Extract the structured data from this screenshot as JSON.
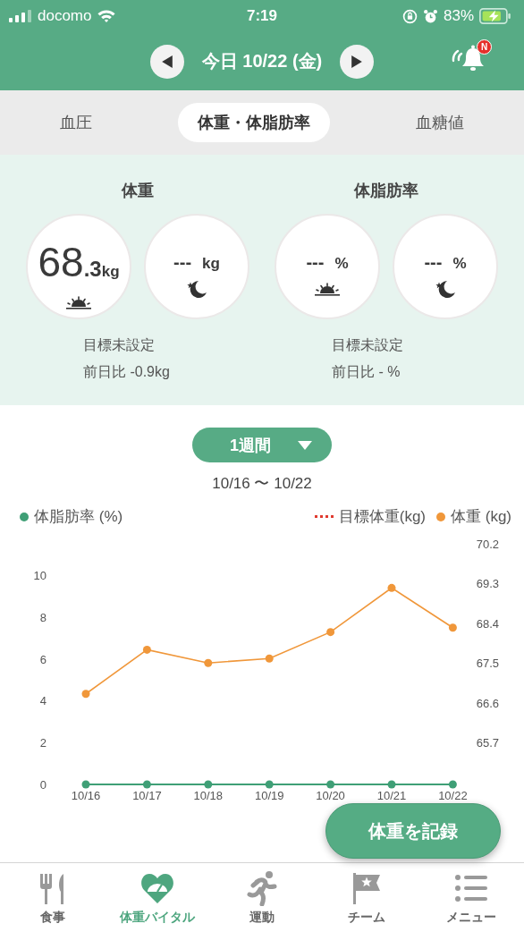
{
  "status_bar": {
    "carrier": "docomo",
    "time": "7:19",
    "battery": "83%"
  },
  "header": {
    "date": "今日 10/22 (金)",
    "badge": "N"
  },
  "tabs": [
    {
      "label": "血圧",
      "selected": false
    },
    {
      "label": "体重・体脂肪率",
      "selected": true
    },
    {
      "label": "血糖値",
      "selected": false
    }
  ],
  "metrics": [
    {
      "title": "体重",
      "readings": [
        {
          "value": "68",
          "fraction": ".3",
          "unit": "kg",
          "kind": "morning"
        },
        {
          "value": "---",
          "unit": "kg",
          "kind": "night"
        }
      ],
      "goal": "目標未設定",
      "diff": "前日比 -0.9kg"
    },
    {
      "title": "体脂肪率",
      "readings": [
        {
          "value": "---",
          "unit": "%",
          "kind": "morning"
        },
        {
          "value": "---",
          "unit": "%",
          "kind": "night"
        }
      ],
      "goal": "目標未設定",
      "diff": "前日比  - %"
    }
  ],
  "period": {
    "label": "1週間",
    "range": "10/16 〜 10/22"
  },
  "target_legend": {
    "label": "目標体重(kg)",
    "color": "#e03a2f"
  },
  "chart_data": {
    "type": "line",
    "categories": [
      "10/16",
      "10/17",
      "10/18",
      "10/19",
      "10/20",
      "10/21",
      "10/22"
    ],
    "series": [
      {
        "name": "体脂肪率 (%)",
        "color": "#3f9f76",
        "marker": true,
        "values": [
          0,
          0,
          0,
          0,
          0,
          0,
          0
        ]
      },
      {
        "name": "体重 (kg)",
        "color": "#f0973a",
        "axis": "y2",
        "marker": true,
        "values": [
          66.8,
          67.8,
          67.5,
          67.6,
          68.2,
          69.2,
          68.3
        ]
      }
    ],
    "ylim": [
      0,
      10
    ],
    "yticks": [
      0,
      2,
      4,
      6,
      8,
      10
    ],
    "y2lim": [
      65.7,
      70.2
    ],
    "y2ticks": [
      {
        "value": 65.7,
        "label": "65.7"
      },
      {
        "value": 66.6,
        "label": "66.6"
      },
      {
        "value": 67.5,
        "label": "67.5"
      },
      {
        "value": 68.4,
        "label": "68.4"
      },
      {
        "value": 69.3,
        "label": "69.3"
      },
      {
        "value": 70.2,
        "label": "70.2"
      }
    ]
  },
  "record_button": "体重を記録",
  "nav": [
    {
      "label": "食事",
      "kind": "meal",
      "selected": false
    },
    {
      "label": "体重バイタル",
      "kind": "vital",
      "selected": true
    },
    {
      "label": "運動",
      "kind": "exercise",
      "selected": false
    },
    {
      "label": "チーム",
      "kind": "team",
      "selected": false
    },
    {
      "label": "メニュー",
      "kind": "menu",
      "selected": false
    }
  ]
}
